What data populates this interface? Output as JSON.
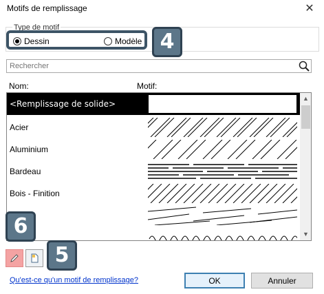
{
  "window": {
    "title": "Motifs de remplissage",
    "close_glyph": "✕"
  },
  "pattern_type": {
    "label": "Type de motif",
    "options": [
      {
        "label": "Dessin",
        "checked": true
      },
      {
        "label": "Modèle",
        "checked": false
      }
    ]
  },
  "callouts": {
    "four": "4",
    "five": "5",
    "six": "6"
  },
  "search": {
    "placeholder": "Rechercher",
    "icon": "search-icon"
  },
  "columns": {
    "name": "Nom:",
    "pattern": "Motif:"
  },
  "patterns": [
    {
      "name": "<Remplissage de solide>",
      "selected": true,
      "style": "solid"
    },
    {
      "name": "Acier",
      "selected": false,
      "style": "diag-steel"
    },
    {
      "name": "Aluminium",
      "selected": false,
      "style": "diag-wide"
    },
    {
      "name": "Bardeau",
      "selected": false,
      "style": "shingle"
    },
    {
      "name": "Bois - Finition",
      "selected": false,
      "style": "diag-dense"
    },
    {
      "name": "",
      "selected": false,
      "style": "wood"
    },
    {
      "name": "",
      "selected": false,
      "style": "curl"
    }
  ],
  "scrollbar": {
    "up": "▲",
    "down": "▼"
  },
  "tools": {
    "edit_icon": "pencil-icon",
    "new_icon": "new-pattern-icon"
  },
  "footer": {
    "help_link": "Qu'est-ce qu'un motif de remplissage?",
    "ok": "OK",
    "cancel": "Annuler"
  },
  "colors": {
    "accent": "#3c7fb1",
    "callout_fill": "#5c7689",
    "callout_border": "#2f4252",
    "edit_highlight": "#f4a3a3",
    "link": "#0033cc"
  }
}
